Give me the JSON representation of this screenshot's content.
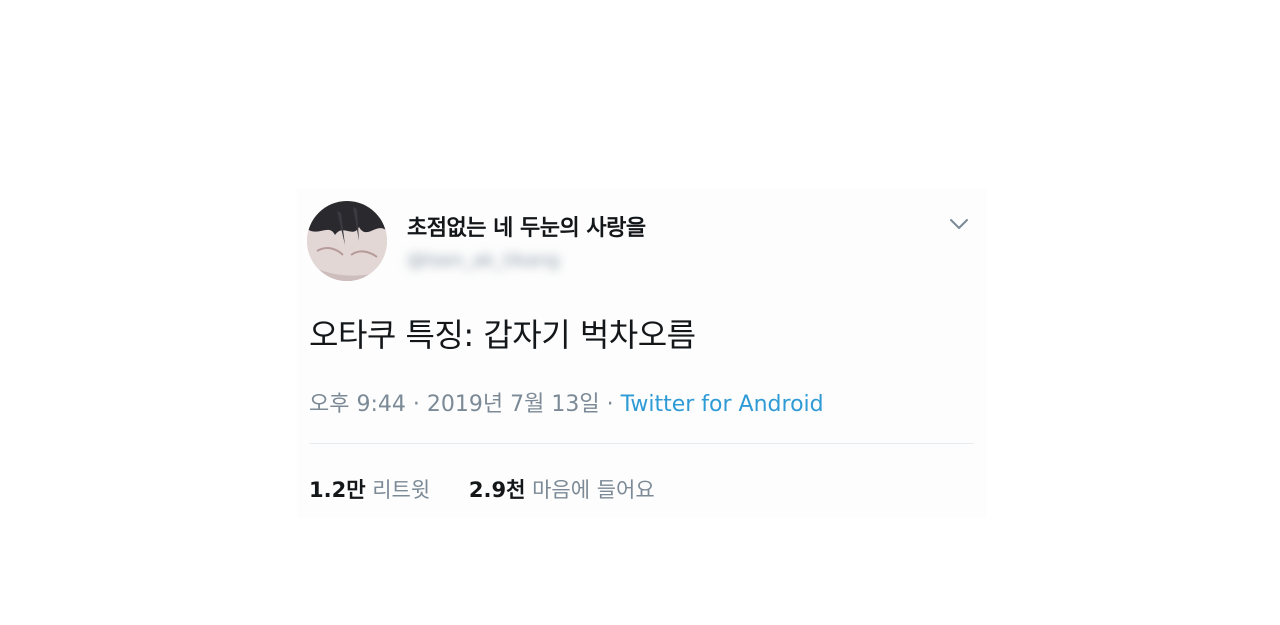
{
  "tweet": {
    "display_name": "초점없는 네 두눈의 사랑을",
    "handle": "@tsen_ak_tikang",
    "text": "오타쿠 특징: 갑자기 벅차오름",
    "time": "오후 9:44",
    "separator": "·",
    "date": "2019년 7월 13일",
    "source": "Twitter for Android",
    "stats": {
      "retweets_count": "1.2만",
      "retweets_label": "리트윗",
      "likes_count": "2.9천",
      "likes_label": "마음에 들어요"
    }
  },
  "icons": {
    "caret": "chevron-down-icon",
    "avatar": "avatar"
  },
  "colors": {
    "text_primary": "#14171a",
    "text_secondary": "#7b8a96",
    "link": "#2f9bd6",
    "divider": "#e6ecf0"
  }
}
